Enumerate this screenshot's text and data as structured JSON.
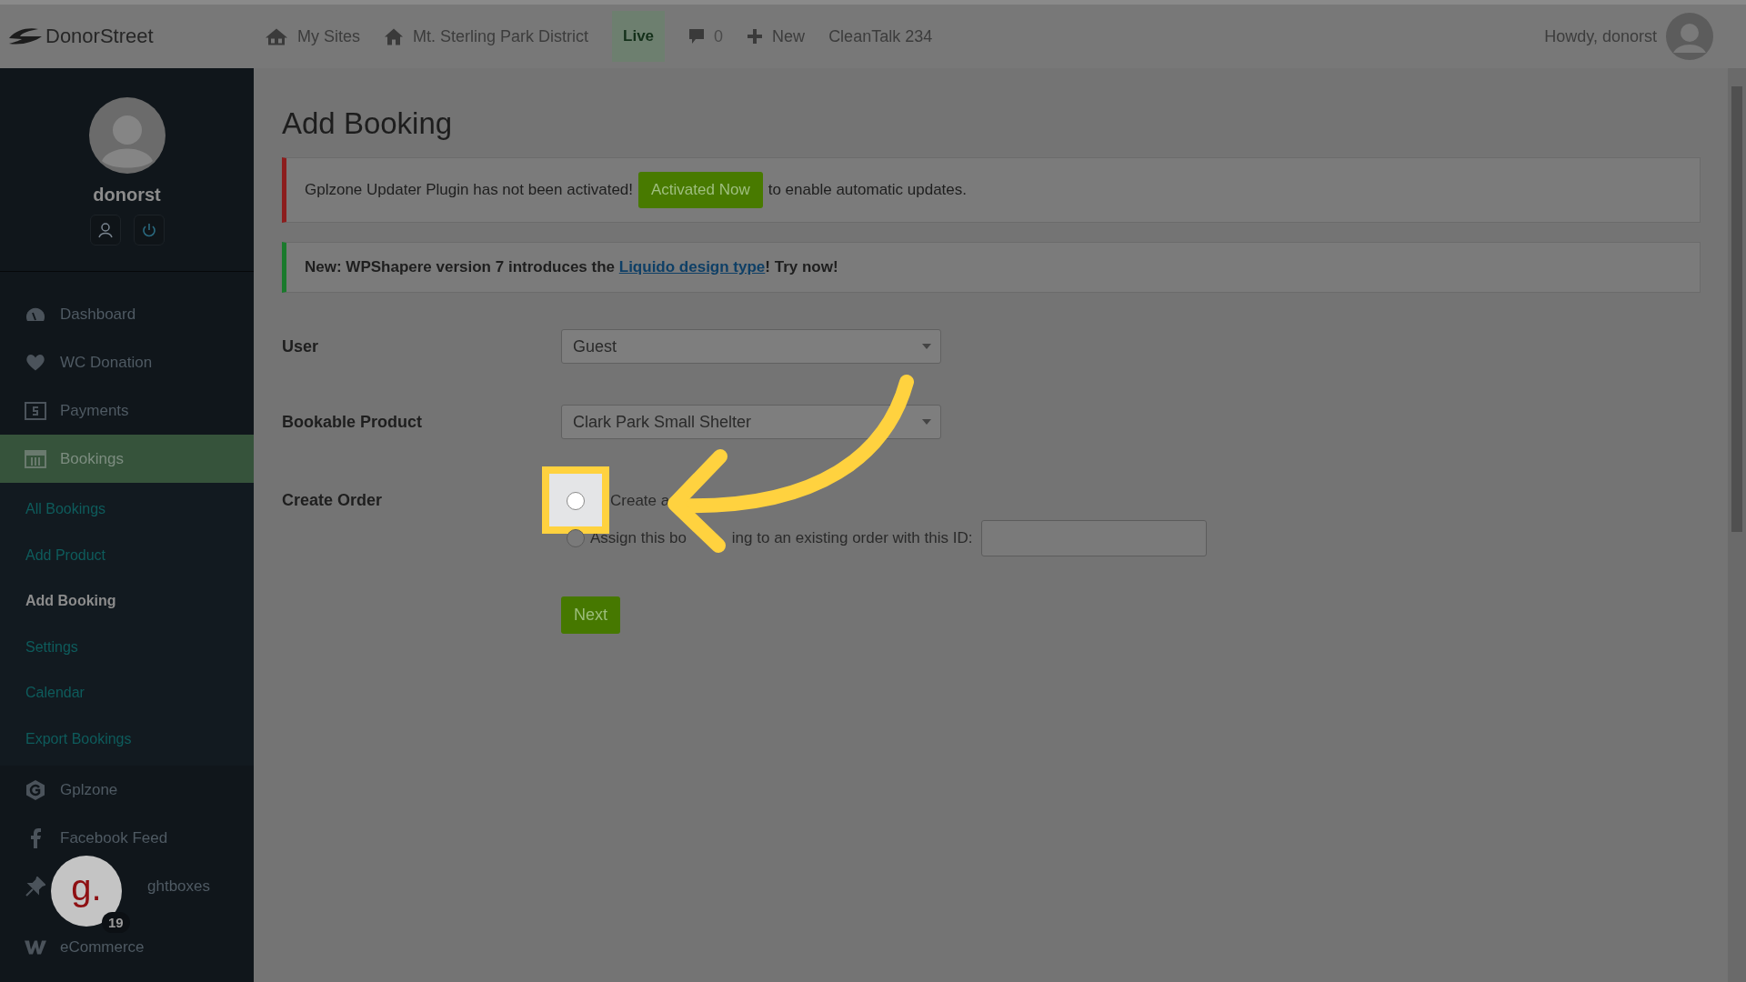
{
  "top_bar": {
    "logo": "DonorStreet",
    "items": [
      {
        "kind": "sites",
        "label": "My Sites"
      },
      {
        "kind": "home",
        "label": "Mt. Sterling Park District"
      },
      {
        "kind": "badge",
        "label": "Live"
      },
      {
        "kind": "comments",
        "label": "0"
      },
      {
        "kind": "new",
        "label": "New"
      },
      {
        "kind": "text",
        "label": "CleanTalk 234"
      }
    ],
    "greeting": "Howdy, donorst"
  },
  "sidebar": {
    "username": "donorst",
    "menu": [
      {
        "kind": "dashboard",
        "label": "Dashboard",
        "selected": false
      },
      {
        "kind": "heart",
        "label": "WC Donation",
        "selected": false
      },
      {
        "kind": "dollar",
        "label": "Payments",
        "selected": false
      },
      {
        "kind": "calendar",
        "label": "Bookings",
        "selected": true,
        "children": [
          {
            "label": "All Bookings",
            "selected": false
          },
          {
            "label": "Add Product",
            "selected": false
          },
          {
            "label": "Add Booking",
            "selected": true
          },
          {
            "label": "Settings",
            "selected": false
          },
          {
            "label": "Calendar",
            "selected": false
          },
          {
            "label": "Export Bookings",
            "selected": false
          }
        ]
      },
      {
        "kind": "gplzone",
        "label": "Gplzone",
        "selected": false
      },
      {
        "kind": "facebook",
        "label": "Facebook Feed",
        "selected": false
      },
      {
        "kind": "pin",
        "label": "ghtboxes",
        "selected": false
      },
      {
        "kind": "w",
        "label": "eCommerce",
        "selected": false
      }
    ]
  },
  "chat_widget": {
    "logo": "g.",
    "badge": "19"
  },
  "page": {
    "title": "Add Booking",
    "notices": [
      {
        "kind": "error",
        "text": "Gplzone Updater Plugin has not been activated!",
        "button": "Activated Now",
        "after": "to enable automatic updates."
      },
      {
        "kind": "success",
        "text": "New: WPShapere version 7 introduces the",
        "link": "Liquido design type",
        "after": "! Try now!"
      }
    ],
    "form": {
      "user": {
        "label": "User",
        "value": "Guest"
      },
      "product": {
        "label": "Bookable Product",
        "value": "Clark Park Small Shelter"
      },
      "create_order": {
        "label": "Create Order",
        "options": [
          {
            "kind": "plain",
            "label": "Create a",
            "checked": false
          },
          {
            "kind": "with_id",
            "label": "Assign this bo",
            "label_after": "ing to an existing order with this ID:",
            "checked": false
          }
        ]
      },
      "next": "Next"
    }
  }
}
